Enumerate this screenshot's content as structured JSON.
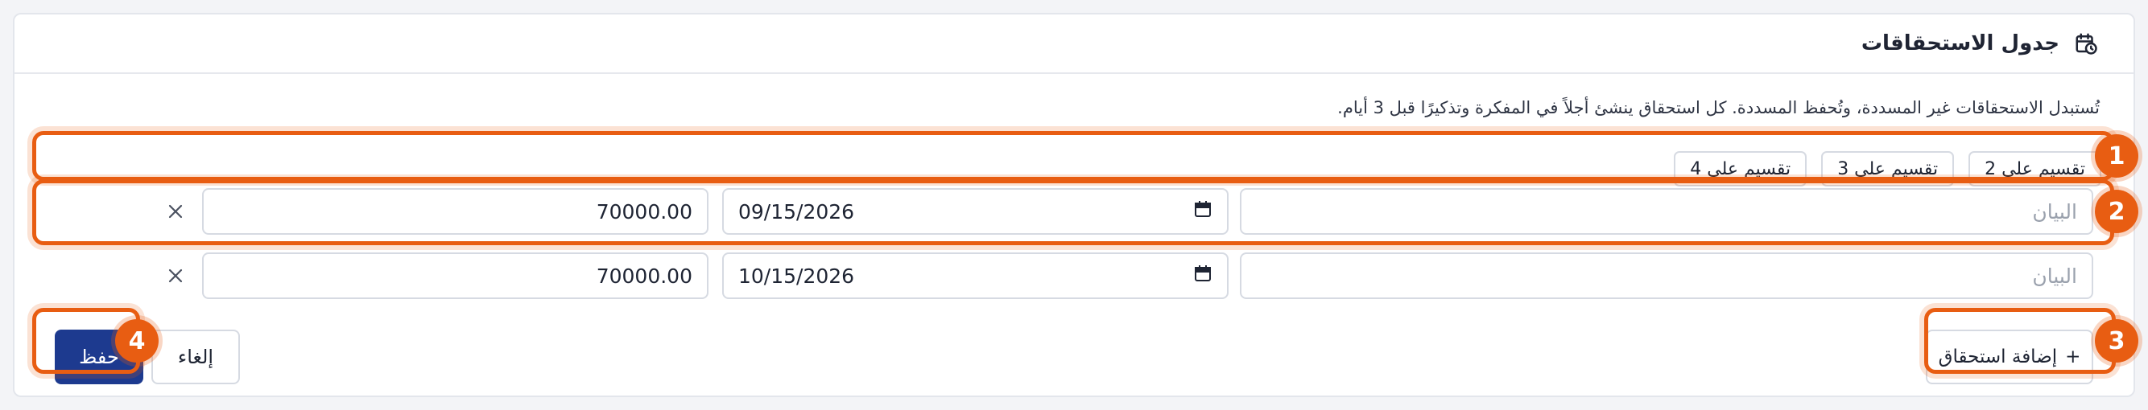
{
  "header": {
    "title": "جدول الاستحقاقات",
    "icon": "calendar-clock-icon"
  },
  "description": "تُستبدل الاستحقاقات غير المسددة، وتُحفظ المسددة. كل استحقاق ينشئ أجلاً في المفكرة وتذكيرًا قبل 3 أيام.",
  "split_buttons": [
    {
      "label": "تقسيم على 2"
    },
    {
      "label": "تقسيم على 3"
    },
    {
      "label": "تقسيم على 4"
    }
  ],
  "installments": [
    {
      "description_placeholder": "البيان",
      "date": "09/15/2026",
      "amount": "70000.00"
    },
    {
      "description_placeholder": "البيان",
      "date": "10/15/2026",
      "amount": "70000.00"
    }
  ],
  "footer": {
    "add_label": "إضافة استحقاق",
    "add_symbol": "+",
    "save_label": "حفظ",
    "cancel_label": "إلغاء"
  },
  "annotations": [
    "1",
    "2",
    "3",
    "4"
  ],
  "colors": {
    "accent": "#e85d12",
    "primary": "#1d3a8f",
    "border": "#d6dae2"
  }
}
